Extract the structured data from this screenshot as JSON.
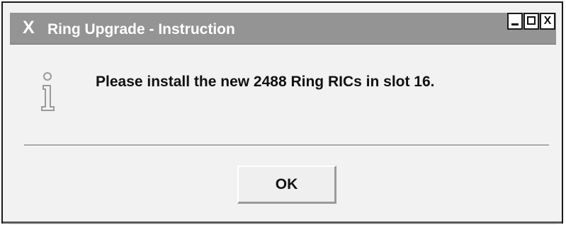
{
  "window": {
    "title": "Ring Upgrade - Instruction",
    "logo": "X",
    "controls": {
      "minimize_icon": "minimize-icon",
      "maximize_icon": "maximize-icon",
      "close_label": "X"
    }
  },
  "dialog": {
    "icon": "info-icon",
    "message": "Please install the new 2488 Ring RICs in slot 16.",
    "ok_label": "OK"
  },
  "colors": {
    "titlebar": "#949494",
    "background": "#f2f2f2",
    "text": "#111111"
  }
}
